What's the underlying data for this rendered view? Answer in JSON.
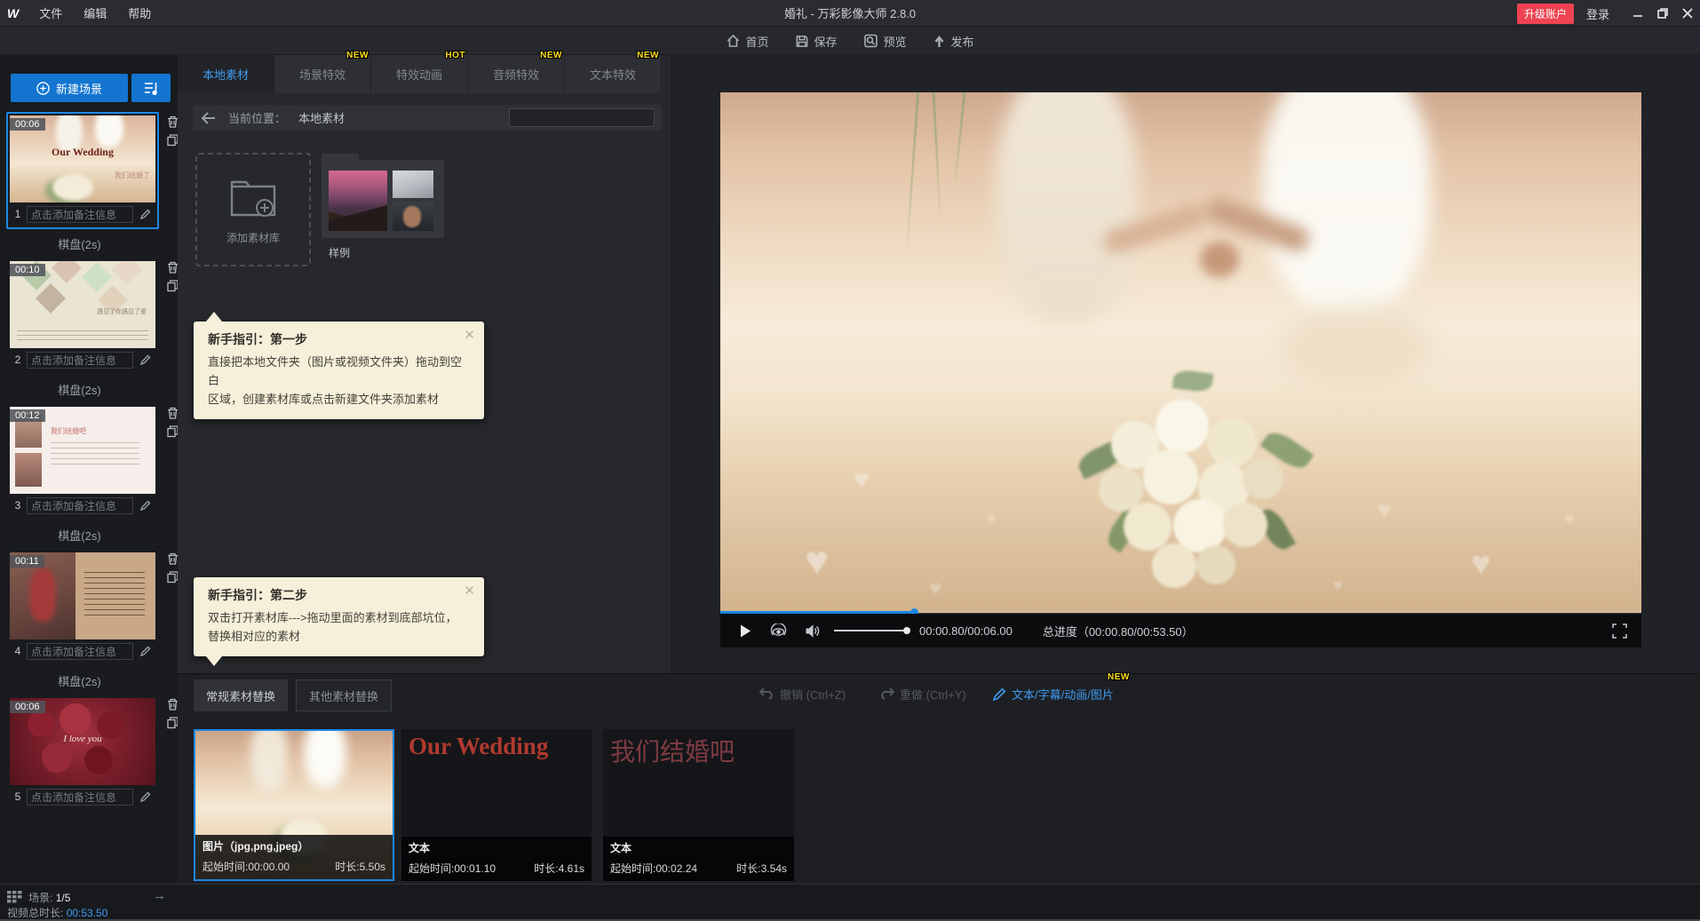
{
  "window": {
    "title": "婚礼 - 万彩影像大师 2.8.0",
    "menus": {
      "file": "文件",
      "edit": "编辑",
      "help": "帮助"
    },
    "upgrade_label": "升级账户",
    "login_label": "登录"
  },
  "toolbar": {
    "home": "首页",
    "save": "保存",
    "preview": "预览",
    "publish": "发布"
  },
  "colors": {
    "accent_blue": "#1787e0",
    "link_blue": "#3f9bf2",
    "badge_yellow": "#ffdf1b",
    "upgrade_red": "#ef4352",
    "tooltip_bg": "#f6f0da",
    "selection_blue": "#1e88e5"
  },
  "sidebar": {
    "new_scene_label": "新建场景",
    "scenes": [
      {
        "num": "1",
        "time": "00:06",
        "note": "点击添加备注信息",
        "overlay_title": "Our Wedding",
        "overlay_sub": "我们结婚了"
      },
      {
        "num": "2",
        "time": "00:10",
        "note": "点击添加备注信息",
        "caption": "遇见了你遇见了爱"
      },
      {
        "num": "3",
        "time": "00:12",
        "note": "点击添加备注信息",
        "caption": "我们结婚吧"
      },
      {
        "num": "4",
        "time": "00:11",
        "note": "点击添加备注信息"
      },
      {
        "num": "5",
        "time": "00:06",
        "note": "点击添加备注信息",
        "caption": "I love you"
      }
    ],
    "transitions": [
      "棋盘(2s)",
      "棋盘(2s)",
      "棋盘(2s)",
      "棋盘(2s)"
    ],
    "footer": {
      "scene_label": "场景:",
      "scene_value": "1/5",
      "arrow": "→",
      "duration_label": "视频总时长:",
      "duration_value": "00:53.50"
    }
  },
  "materials": {
    "tabs": [
      {
        "label": "本地素材",
        "active": true
      },
      {
        "label": "场景特效",
        "badge": "NEW"
      },
      {
        "label": "特效动画",
        "badge": "HOT"
      },
      {
        "label": "音频特效",
        "badge": "NEW"
      },
      {
        "label": "文本特效",
        "badge": "NEW"
      }
    ],
    "location_label": "当前位置：",
    "location_value": "本地素材",
    "search_value": "",
    "add_library_label": "添加素材库",
    "sample_folder_label": "样例",
    "tips": [
      {
        "title": "新手指引：第一步",
        "lines": [
          "直接把本地文件夹（图片或视频文件夹）拖动到空白",
          "区域，创建素材库或点击新建文件夹添加素材"
        ]
      },
      {
        "title": "新手指引：第二步",
        "lines": [
          "双击打开素材库--->拖动里面的素材到底部坑位，",
          "替换相对应的素材"
        ]
      }
    ]
  },
  "player": {
    "time_text": "00:00.80/00:06.00",
    "total_text": "总进度（00:00.80/00:53.50）",
    "progress_pct": 21,
    "volume_pct": 100
  },
  "bottom": {
    "tabs": [
      "常规素材替换",
      "其他素材替换"
    ],
    "undo_label": "撤销 (Ctrl+Z)",
    "redo_label": "重做 (Ctrl+Y)",
    "text_tool_label": "文本/字幕/动画/图片",
    "text_tool_badge": "NEW",
    "cards": [
      {
        "type_label": "图片（jpg,png,jpeg）",
        "start_label": "起始时间:00:00.00",
        "dur_label": "时长:5.50s",
        "selected": true
      },
      {
        "type_label": "文本",
        "start_label": "起始时间:00:01.10",
        "dur_label": "时长:4.61s",
        "preview_text": "Our Wedding"
      },
      {
        "type_label": "文本",
        "start_label": "起始时间:00:02.24",
        "dur_label": "时长:3.54s",
        "preview_text": "我们结婚吧"
      }
    ]
  }
}
